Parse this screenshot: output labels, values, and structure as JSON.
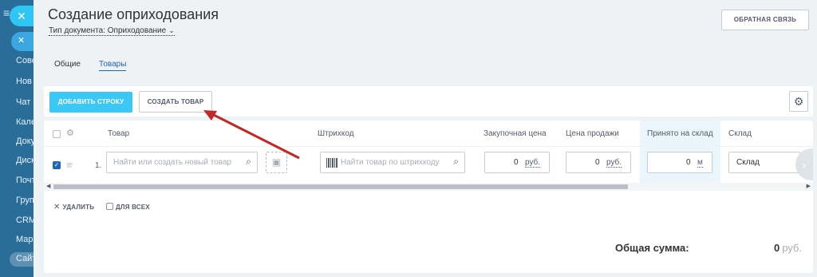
{
  "sidebar": {
    "items": [
      "Сове",
      "Нов",
      "Чат",
      "Кале",
      "Доку",
      "Диск",
      "Почт",
      "Груп",
      "CRM",
      "Мар",
      "Сайт"
    ]
  },
  "header": {
    "title": "Создание оприходования",
    "doc_type_label": "Тип документа:",
    "doc_type_value": "Оприходование",
    "feedback_button": "ОБРАТНАЯ СВЯЗЬ"
  },
  "tabs": [
    {
      "label": "Общие",
      "active": false
    },
    {
      "label": "Товары",
      "active": true
    }
  ],
  "toolbar": {
    "add_row": "ДОБАВИТЬ СТРОКУ",
    "create_product": "СОЗДАТЬ ТОВАР"
  },
  "table": {
    "columns": [
      "Товар",
      "Штрихкод",
      "Закупочная цена",
      "Цена продажи",
      "Принято на склад",
      "Склад"
    ],
    "row": {
      "num": "1.",
      "product_placeholder": "Найти или создать новый товар",
      "barcode_placeholder": "Найти товар по штрихкоду",
      "purchase_price": "0",
      "purchase_currency": "руб.",
      "sale_price": "0",
      "sale_currency": "руб.",
      "accepted": "0",
      "accepted_unit": "м",
      "warehouse": "Склад"
    }
  },
  "actions": {
    "delete": "УДАЛИТЬ",
    "for_all": "ДЛЯ ВСЕХ"
  },
  "total": {
    "label": "Общая сумма:",
    "value": "0",
    "currency": "руб."
  },
  "colors": {
    "accent": "#3bc8f5",
    "link": "#2067b0",
    "annotation_arrow": "#c0282a"
  }
}
